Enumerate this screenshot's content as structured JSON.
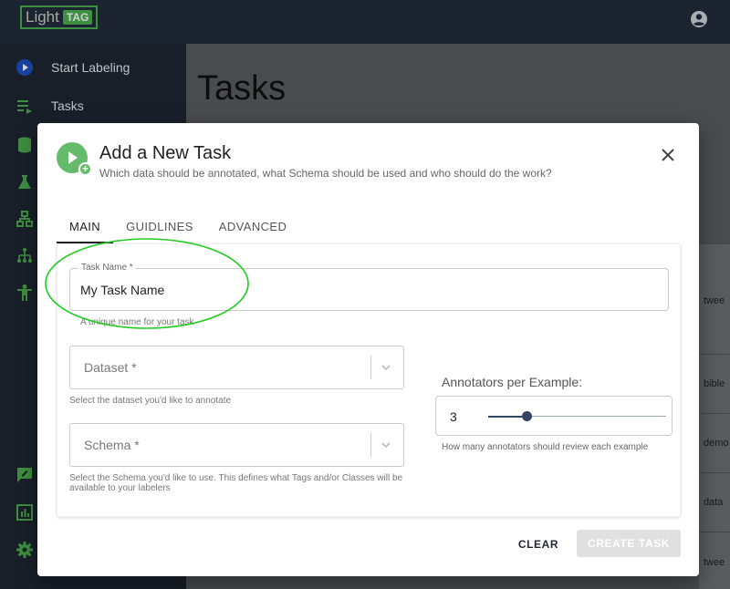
{
  "app": {
    "logo_text": "Light",
    "logo_badge": "TAG",
    "account_icon": "account-circle-icon"
  },
  "sidebar": {
    "items": [
      {
        "label": "Start Labeling",
        "icon": "play-circle-icon"
      },
      {
        "label": "Tasks",
        "icon": "playlist-play-icon"
      }
    ],
    "icons_only": [
      "database-icon",
      "flask-icon",
      "schema-icon",
      "sitemap-icon",
      "person-icon",
      "feedback-icon",
      "bar-chart-icon",
      "gear-icon"
    ]
  },
  "page": {
    "title": "Tasks",
    "row_labels": [
      "twee",
      "bible",
      "demo",
      "data",
      "twee"
    ]
  },
  "dialog": {
    "title": "Add a New Task",
    "subtitle": "Which data should be annotated, what Schema should be used and who should do the work?",
    "tabs": [
      {
        "label": "MAIN",
        "active": true
      },
      {
        "label": "GUIDLINES",
        "active": false
      },
      {
        "label": "ADVANCED",
        "active": false
      }
    ],
    "task_name": {
      "label": "Task Name *",
      "value": "My Task Name",
      "helper": "A unique name for your task"
    },
    "dataset": {
      "placeholder": "Dataset *",
      "helper": "Select the dataset you'd like to annotate"
    },
    "schema": {
      "placeholder": "Schema *",
      "helper": "Select the Schema you'd like to use. This defines what Tags and/or Classes will be available to your labelers"
    },
    "annotators": {
      "label": "Annotators per Example:",
      "value": "3",
      "slider_fraction": 0.22,
      "helper": "How many annotators should review each example"
    },
    "buttons": {
      "clear": "CLEAR",
      "create": "CREATE TASK"
    }
  },
  "colors": {
    "accent_green": "#4caf50",
    "primary_navy": "#1f2633",
    "highlight_green": "#22cc22"
  }
}
